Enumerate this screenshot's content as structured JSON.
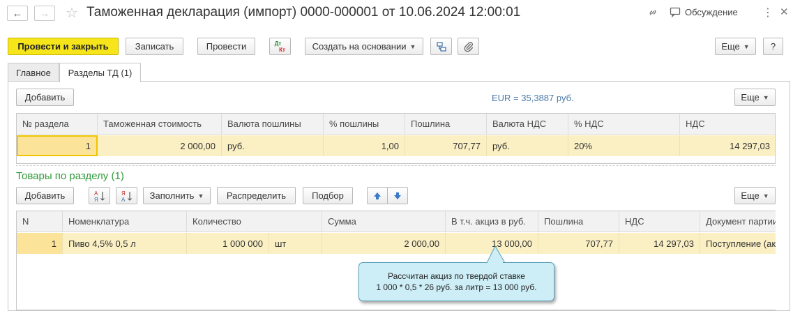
{
  "window": {
    "title": "Таможенная декларация (импорт) 0000-000001 от 10.06.2024 12:00:01",
    "discussion_label": "Обсуждение"
  },
  "toolbar": {
    "post_and_close": "Провести и закрыть",
    "save": "Записать",
    "post": "Провести",
    "dt_kt_top": "Дт",
    "dt_kt_bottom": "Кт",
    "create_based_on": "Создать на основании",
    "more": "Еще",
    "help": "?"
  },
  "tabs": [
    {
      "label": "Главное"
    },
    {
      "label": "Разделы ТД (1)"
    }
  ],
  "sections": {
    "add": "Добавить",
    "rate_text": "EUR = 35,3887 руб.",
    "more": "Еще",
    "columns": [
      "№ раздела",
      "Таможенная стоимость",
      "Валюта пошлины",
      "% пошлины",
      "Пошлина",
      "Валюта НДС",
      "% НДС",
      "НДС"
    ],
    "rows": [
      [
        "1",
        "2 000,00",
        "руб.",
        "1,00",
        "707,77",
        "руб.",
        "20%",
        "14 297,03"
      ]
    ]
  },
  "goods": {
    "title": "Товары по разделу (1)",
    "add": "Добавить",
    "fill": "Заполнить",
    "distribute": "Распределить",
    "select": "Подбор",
    "more": "Еще",
    "sort_icon_top": "А",
    "sort_icon_bottom": "Я",
    "columns": [
      "N",
      "Номенклатура",
      "Количество",
      "Сумма",
      "В т.ч. акциз в руб.",
      "Пошлина",
      "НДС",
      "Документ партии"
    ],
    "rows": [
      [
        "1",
        "Пиво 4,5% 0,5 л",
        "1 000 000",
        "шт",
        "2 000,00",
        "13 000,00",
        "707,77",
        "14 297,03",
        "Поступление (ак"
      ]
    ]
  },
  "callout": {
    "line1": "Рассчитан акциз по твердой ставке",
    "line2": "1 000 * 0,5 * 26 руб. за литр = 13 000 руб."
  },
  "colors": {
    "primary_button": "#f5e51a",
    "row_highlight": "#fbf0c4",
    "section_title": "#2f9a3a",
    "rate_text": "#4a7aaa",
    "callout_bg": "#cdeef6"
  }
}
